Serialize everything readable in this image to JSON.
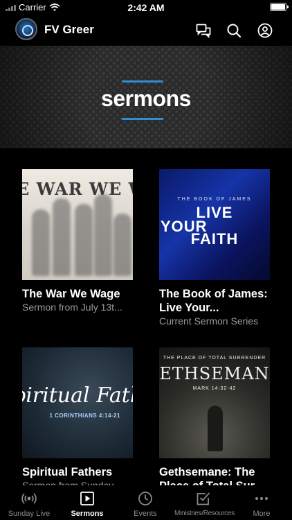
{
  "status_bar": {
    "carrier": "Carrier",
    "time": "2:42 AM"
  },
  "header": {
    "app_name": "FV Greer",
    "icons": [
      "chat-icon",
      "search-icon",
      "profile-icon"
    ]
  },
  "banner": {
    "title": "sermons",
    "accent_color": "#2c8fd6"
  },
  "sermons": [
    {
      "title": "The War We Wage",
      "subtitle": "Sermon from July 13t...",
      "thumb_text": "E WAR WE WA"
    },
    {
      "title": "The Book of James: Live Your...",
      "subtitle": "Current Sermon Series",
      "thumb_small": "THE BOOK OF JAMES",
      "thumb_lines": [
        "LIVE",
        "YOUR",
        "FAITH"
      ]
    },
    {
      "title": "Spiritual Fathers",
      "subtitle": "Sermon from Sunday...",
      "thumb_text": "piritual Fath",
      "thumb_ref": "1 CORINTHIANS 4:14-21"
    },
    {
      "title": "Gethsemane: The Place of Total Sur...",
      "subtitle": "",
      "thumb_small": "THE PLACE OF TOTAL SURRENDER",
      "thumb_text": "ETHSEMAN",
      "thumb_ref": "MARK 14:32-42"
    }
  ],
  "tabs": [
    {
      "label": "Sunday Live",
      "icon": "live-broadcast-icon"
    },
    {
      "label": "Sermons",
      "icon": "play-square-icon",
      "active": true
    },
    {
      "label": "Events",
      "icon": "clock-icon"
    },
    {
      "label": "Ministries/Resources",
      "icon": "checkbox-icon"
    },
    {
      "label": "More",
      "icon": "more-dots-icon"
    }
  ]
}
